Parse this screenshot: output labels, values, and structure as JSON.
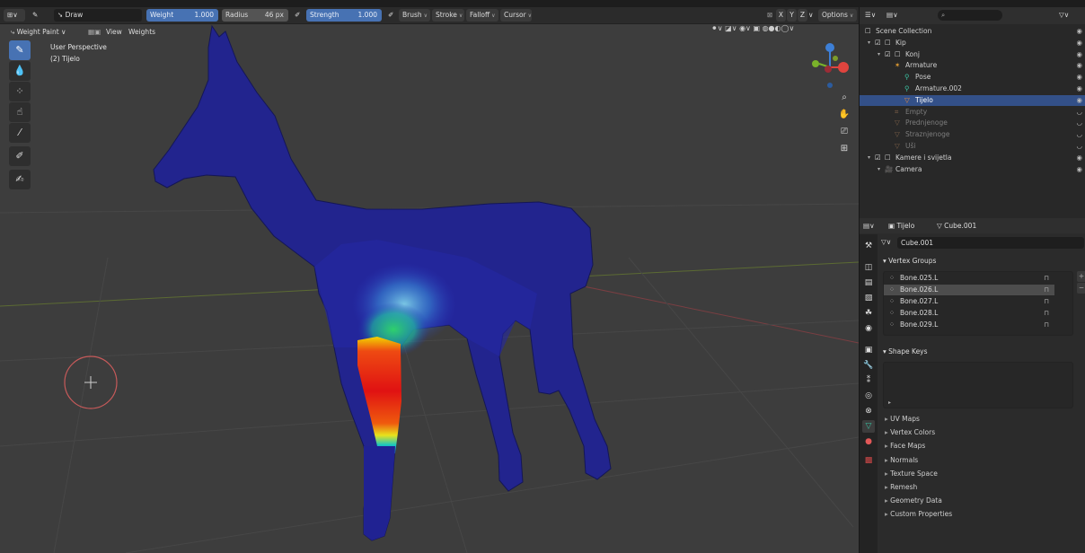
{
  "top_bar": {
    "tool_name": "Draw",
    "weight_label": "Weight",
    "weight_value": "1.000",
    "radius_label": "Radius",
    "radius_value": "46 px",
    "strength_label": "Strength",
    "strength_value": "1.000",
    "brush_menu": "Brush",
    "stroke_menu": "Stroke",
    "falloff_menu": "Falloff",
    "cursor_menu": "Cursor",
    "options_menu": "Options",
    "axis_x": "X",
    "axis_y": "Y",
    "axis_z": "Z"
  },
  "header": {
    "mode": "Weight Paint",
    "menu_view": "View",
    "menu_weights": "Weights"
  },
  "viewport": {
    "perspective_label": "User Perspective",
    "object_label": "(2) Tijelo",
    "gizmo_colors": {
      "x": "#e0443e",
      "y": "#7ab32a",
      "z": "#3d7fd6"
    }
  },
  "toolbar": {
    "tools": [
      "draw-tool",
      "blur-tool",
      "average-tool",
      "smear-tool",
      "gradient-tool",
      "sample-weight-tool",
      "annotate-tool"
    ]
  },
  "outliner": {
    "search_placeholder": "",
    "rows": [
      {
        "label": "Scene Collection",
        "indent": 0,
        "icon": "collection-icon",
        "selected": false,
        "dim": false
      },
      {
        "label": "Kip",
        "indent": 1,
        "icon": "collection-icon",
        "selected": false,
        "dim": false
      },
      {
        "label": "Konj",
        "indent": 2,
        "icon": "collection-icon",
        "selected": false,
        "dim": false
      },
      {
        "label": "Armature",
        "indent": 3,
        "icon": "armature-icon",
        "selected": false,
        "dim": false
      },
      {
        "label": "Pose",
        "indent": 4,
        "icon": "pose-icon",
        "selected": false,
        "dim": false
      },
      {
        "label": "Armature.002",
        "indent": 4,
        "icon": "armature-data-icon",
        "selected": false,
        "dim": false
      },
      {
        "label": "Tijelo",
        "indent": 4,
        "icon": "mesh-icon",
        "selected": true,
        "dim": false
      },
      {
        "label": "Empty",
        "indent": 3,
        "icon": "empty-icon",
        "selected": false,
        "dim": true
      },
      {
        "label": "Prednjenoge",
        "indent": 3,
        "icon": "mesh-icon",
        "selected": false,
        "dim": true
      },
      {
        "label": "Straznjenoge",
        "indent": 3,
        "icon": "mesh-icon",
        "selected": false,
        "dim": true
      },
      {
        "label": "Uši",
        "indent": 3,
        "icon": "mesh-icon",
        "selected": false,
        "dim": true
      },
      {
        "label": "Kamere i svijetla",
        "indent": 1,
        "icon": "collection-icon",
        "selected": false,
        "dim": false
      },
      {
        "label": "Camera",
        "indent": 2,
        "icon": "camera-icon",
        "selected": false,
        "dim": false
      }
    ]
  },
  "properties": {
    "breadcrumb_object": "Tijelo",
    "breadcrumb_data": "Cube.001",
    "mesh_name": "Cube.001",
    "vertex_groups_label": "Vertex Groups",
    "vertex_groups": [
      "Bone.025.L",
      "Bone.026.L",
      "Bone.027.L",
      "Bone.028.L",
      "Bone.029.L"
    ],
    "selected_vertex_group": "Bone.026.L",
    "shape_keys_label": "Shape Keys",
    "collapsed_panels": [
      "UV Maps",
      "Vertex Colors",
      "Face Maps",
      "Normals",
      "Texture Space",
      "Remesh",
      "Geometry Data",
      "Custom Properties"
    ]
  }
}
